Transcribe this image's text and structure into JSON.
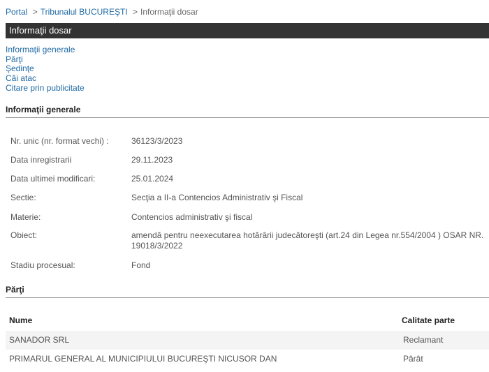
{
  "breadcrumb": {
    "items": [
      "Portal",
      "Tribunalul BUCUREŞTI",
      "Informaţii dosar"
    ],
    "separator": ">"
  },
  "title": "Informaţii dosar",
  "nav": {
    "items": [
      "Informaţii generale",
      "Părţi",
      "Şedinţe",
      "Căi atac",
      "Citare prin publicitate"
    ]
  },
  "general": {
    "heading": "Informaţii generale",
    "rows": [
      {
        "label": "Nr. unic (nr. format vechi) :",
        "value": "36123/3/2023"
      },
      {
        "label": "Data inregistrarii",
        "value": "29.11.2023"
      },
      {
        "label": "Data ultimei modificari:",
        "value": "25.01.2024"
      },
      {
        "label": "Sectie:",
        "value": "Secţia a II-a Contencios Administrativ şi Fiscal"
      },
      {
        "label": "Materie:",
        "value": "Contencios administrativ şi fiscal"
      },
      {
        "label": "Obiect:",
        "value": "amendă pentru neexecutarea hotărârii judecătoreşti (art.24 din Legea nr.554/2004 ) OSAR NR. 19018/3/2022"
      },
      {
        "label": "Stadiu procesual:",
        "value": "Fond"
      }
    ]
  },
  "parti": {
    "heading": "Părţi",
    "columns": [
      "Nume",
      "Calitate parte"
    ],
    "rows": [
      {
        "nume": "SANADOR SRL",
        "calitate": "Reclamant"
      },
      {
        "nume": "PRIMARUL GENERAL AL MUNICIPIULUI BUCUREŞTI NICUSOR DAN",
        "calitate": "Pârât"
      }
    ]
  },
  "colors": {
    "title_bar": "#333333",
    "link": "#1f6aa5",
    "row_alt": "#f4f4f4"
  }
}
